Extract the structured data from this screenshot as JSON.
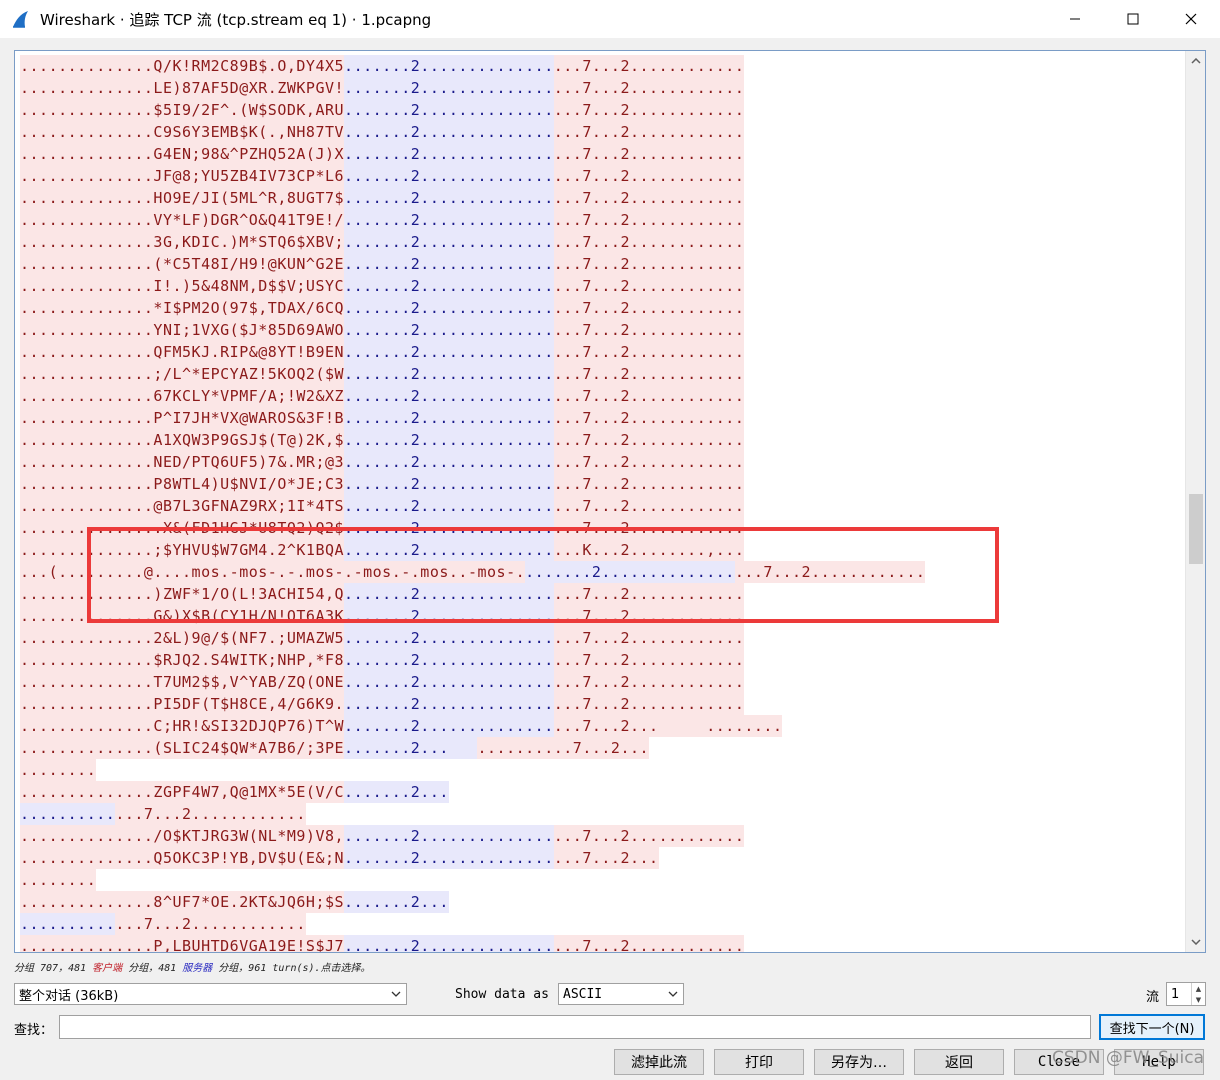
{
  "window": {
    "title": "Wireshark · 追踪 TCP 流 (tcp.stream eq 1) · 1.pcapng"
  },
  "stream": {
    "lines": [
      [
        {
          "k": "c",
          "t": "..............Q/K!RM2C89B$.O,DY4X5"
        },
        {
          "k": "s",
          "t": ".......2.............."
        },
        {
          "k": "c",
          "t": "...7...2............"
        }
      ],
      [
        {
          "k": "c",
          "t": "..............LE)87AF5D@XR.ZWKPGV!"
        },
        {
          "k": "s",
          "t": ".......2.............."
        },
        {
          "k": "c",
          "t": "...7...2............"
        }
      ],
      [
        {
          "k": "c",
          "t": "..............$5I9/2F^.(W$SODK,ARU"
        },
        {
          "k": "s",
          "t": ".......2.............."
        },
        {
          "k": "c",
          "t": "...7...2............"
        }
      ],
      [
        {
          "k": "c",
          "t": "..............C9S6Y3EMB$K(.,NH87TV"
        },
        {
          "k": "s",
          "t": ".......2.............."
        },
        {
          "k": "c",
          "t": "...7...2............"
        }
      ],
      [
        {
          "k": "c",
          "t": "..............G4EN;98&^PZHQ52A(J)X"
        },
        {
          "k": "s",
          "t": ".......2.............."
        },
        {
          "k": "c",
          "t": "...7...2............"
        }
      ],
      [
        {
          "k": "c",
          "t": "..............JF@8;YU5ZB4IV73CP*L6"
        },
        {
          "k": "s",
          "t": ".......2.............."
        },
        {
          "k": "c",
          "t": "...7...2............"
        }
      ],
      [
        {
          "k": "c",
          "t": "..............HO9E/JI(5ML^R,8UGT7$"
        },
        {
          "k": "s",
          "t": ".......2.............."
        },
        {
          "k": "c",
          "t": "...7...2............"
        }
      ],
      [
        {
          "k": "c",
          "t": "..............VY*LF)DGR^O&Q41T9E!/"
        },
        {
          "k": "s",
          "t": ".......2.............."
        },
        {
          "k": "c",
          "t": "...7...2............"
        }
      ],
      [
        {
          "k": "c",
          "t": "..............3G,KDIC.)M*STQ6$XBV;"
        },
        {
          "k": "s",
          "t": ".......2.............."
        },
        {
          "k": "c",
          "t": "...7...2............"
        }
      ],
      [
        {
          "k": "c",
          "t": "..............(*C5T48I/H9!@KUN^G2E"
        },
        {
          "k": "s",
          "t": ".......2.............."
        },
        {
          "k": "c",
          "t": "...7...2............"
        }
      ],
      [
        {
          "k": "c",
          "t": "..............I!.)5&48NM,D$$V;USYC"
        },
        {
          "k": "s",
          "t": ".......2.............."
        },
        {
          "k": "c",
          "t": "...7...2............"
        }
      ],
      [
        {
          "k": "c",
          "t": "..............*I$PM2O(97$,TDAX/6CQ"
        },
        {
          "k": "s",
          "t": ".......2.............."
        },
        {
          "k": "c",
          "t": "...7...2............"
        }
      ],
      [
        {
          "k": "c",
          "t": "..............YNI;1VXG($J*85D69AWO"
        },
        {
          "k": "s",
          "t": ".......2.............."
        },
        {
          "k": "c",
          "t": "...7...2............"
        }
      ],
      [
        {
          "k": "c",
          "t": "..............QFM5KJ.RIP&@8YT!B9EN"
        },
        {
          "k": "s",
          "t": ".......2.............."
        },
        {
          "k": "c",
          "t": "...7...2............"
        }
      ],
      [
        {
          "k": "c",
          "t": "..............;/L^*EPCYAZ!5KOQ2($W"
        },
        {
          "k": "s",
          "t": ".......2.............."
        },
        {
          "k": "c",
          "t": "...7...2............"
        }
      ],
      [
        {
          "k": "c",
          "t": "..............67KCLY*VPMF/A;!W2&XZ"
        },
        {
          "k": "s",
          "t": ".......2.............."
        },
        {
          "k": "c",
          "t": "...7...2............"
        }
      ],
      [
        {
          "k": "c",
          "t": "..............P^I7JH*VX@WAROS&3F!B"
        },
        {
          "k": "s",
          "t": ".......2.............."
        },
        {
          "k": "c",
          "t": "...7...2............"
        }
      ],
      [
        {
          "k": "c",
          "t": "..............A1XQW3P9GSJ$(T@)2K,$"
        },
        {
          "k": "s",
          "t": ".......2.............."
        },
        {
          "k": "c",
          "t": "...7...2............"
        }
      ],
      [
        {
          "k": "c",
          "t": "..............NED/PTQ6UF5)7&.MR;@3"
        },
        {
          "k": "s",
          "t": ".......2.............."
        },
        {
          "k": "c",
          "t": "...7...2............"
        }
      ],
      [
        {
          "k": "c",
          "t": "..............P8WTL4)U$NVI/O*JE;C3"
        },
        {
          "k": "s",
          "t": ".......2.............."
        },
        {
          "k": "c",
          "t": "...7...2............"
        }
      ],
      [
        {
          "k": "c",
          "t": "..............@B7L3GFNAZ9RX;1I*4TS"
        },
        {
          "k": "s",
          "t": ".......2.............."
        },
        {
          "k": "c",
          "t": "...7...2............"
        }
      ],
      [
        {
          "k": "c",
          "t": "...............X&(FD1HGJ*U8TQ2)Q2$"
        },
        {
          "k": "s",
          "t": ".......2.............."
        },
        {
          "k": "c",
          "t": "...7...2............"
        }
      ],
      [
        {
          "k": "c",
          "t": "..............;$YHVU$W7GM4.2^K1BQA"
        },
        {
          "k": "s",
          "t": ".......2.............."
        },
        {
          "k": "c",
          "t": "...K...2........,..."
        }
      ],
      [
        {
          "k": "c",
          "t": "...(.........@....mos.-mos-.-.mos-.-mos.-.mos..-mos-."
        },
        {
          "k": "s",
          "t": ".......2.............."
        },
        {
          "k": "c",
          "t": "...7...2............"
        }
      ],
      [
        {
          "k": "c",
          "t": "..............)ZWF*1/O(L!3ACHI54,Q"
        },
        {
          "k": "s",
          "t": ".......2.............."
        },
        {
          "k": "c",
          "t": "...7...2............"
        }
      ],
      [
        {
          "k": "c",
          "t": "..............G&)X$B(CY1H/N!OT6A3K"
        },
        {
          "k": "s",
          "t": ".......2.............."
        },
        {
          "k": "c",
          "t": "...7...2............"
        }
      ],
      [
        {
          "k": "c",
          "t": "..............2&L)9@/$(NF7.;UMAZW5"
        },
        {
          "k": "s",
          "t": ".......2.............."
        },
        {
          "k": "c",
          "t": "...7...2............"
        }
      ],
      [
        {
          "k": "c",
          "t": "..............$RJQ2.S4WITK;NHP,*F8"
        },
        {
          "k": "s",
          "t": ".......2.............."
        },
        {
          "k": "c",
          "t": "...7...2............"
        }
      ],
      [
        {
          "k": "c",
          "t": "..............T7UM2$$,V^YAB/ZQ(ONE"
        },
        {
          "k": "s",
          "t": ".......2.............."
        },
        {
          "k": "c",
          "t": "...7...2............"
        }
      ],
      [
        {
          "k": "c",
          "t": "..............PI5DF(T$H8CE,4/G6K9."
        },
        {
          "k": "s",
          "t": ".......2.............."
        },
        {
          "k": "c",
          "t": "...7...2............"
        }
      ],
      [
        {
          "k": "c",
          "t": "..............C;HR!&SI32DJQP76)T^W"
        },
        {
          "k": "s",
          "t": ".......2.............."
        },
        {
          "k": "c",
          "t": "...7...2...     ........"
        }
      ],
      [
        {
          "k": "c",
          "t": "..............(SLIC24$QW*A7B6/;3PE"
        },
        {
          "k": "s",
          "t": ".......2...   "
        },
        {
          "k": "c",
          "t": "..........7...2..."
        }
      ],
      [
        {
          "k": "c",
          "t": "........"
        }
      ],
      [
        {
          "k": "c",
          "t": "..............ZGPF4W7,Q@1MX*5E(V/C"
        },
        {
          "k": "s",
          "t": ".......2..."
        }
      ],
      [
        {
          "k": "s",
          "t": ".........."
        },
        {
          "k": "c",
          "t": "...7...2............"
        }
      ],
      [
        {
          "k": "c",
          "t": "............../O$KTJRG3W(NL*M9)V8,"
        },
        {
          "k": "s",
          "t": ".......2.............."
        },
        {
          "k": "c",
          "t": "...7...2............"
        }
      ],
      [
        {
          "k": "c",
          "t": "..............Q5OKC3P!YB,DV$U(E&;N"
        },
        {
          "k": "s",
          "t": ".......2.............."
        },
        {
          "k": "c",
          "t": "...7...2..."
        }
      ],
      [
        {
          "k": "c",
          "t": "........"
        }
      ],
      [
        {
          "k": "c",
          "t": "..............8^UF7*OE.2KT&JQ6H;$S"
        },
        {
          "k": "s",
          "t": ".......2..."
        }
      ],
      [
        {
          "k": "s",
          "t": ".........."
        },
        {
          "k": "c",
          "t": "...7...2............"
        }
      ],
      [
        {
          "k": "c",
          "t": "..............P,LBUHTD6VGA19E!S$J7"
        },
        {
          "k": "s",
          "t": ".......2.............."
        },
        {
          "k": "c",
          "t": "...7...2............"
        }
      ]
    ]
  },
  "status": {
    "prefix": "分组 707，481 ",
    "client": "客户端",
    "mid1": " 分组，481 ",
    "server": "服务器",
    "suffix": " 分组，961 turn(s).点击选择。"
  },
  "controls": {
    "conversation_select": "整个对话 (36kB)",
    "show_data_as_label": "Show data as",
    "show_data_as_value": "ASCII",
    "stream_label": "流",
    "stream_value": "1",
    "find_label": "查找：",
    "find_value": "",
    "find_next_button": "查找下一个(N)"
  },
  "buttons": {
    "filter_out": "滤掉此流",
    "print": "打印",
    "save_as": "另存为…",
    "back": "返回",
    "close": "Close",
    "help": "Help"
  },
  "watermark": "CSDN @FW_Suica",
  "colors": {
    "client_bg": "#fbe6e6",
    "client_fg": "#8b1a1a",
    "server_bg": "#e8e8fb",
    "server_fg": "#1a1a8b",
    "highlight_box": "#ec3a3a"
  }
}
